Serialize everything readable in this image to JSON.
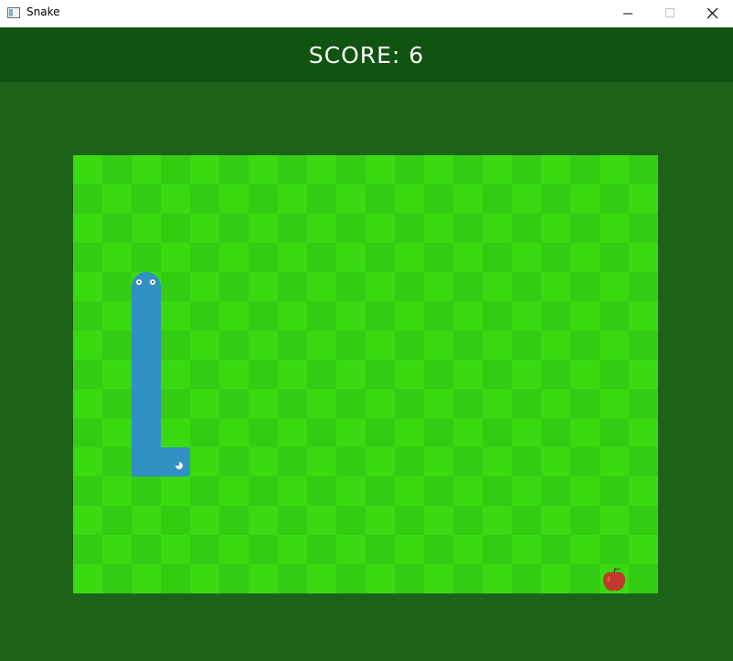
{
  "window": {
    "title": "Snake"
  },
  "hud": {
    "score_text": "SCORE: 6"
  },
  "game": {
    "score": 6,
    "grid": {
      "columns": 20,
      "rows": 15
    },
    "snake": {
      "direction": "up",
      "cells": [
        [
          2,
          4
        ],
        [
          2,
          5
        ],
        [
          2,
          6
        ],
        [
          2,
          7
        ],
        [
          2,
          8
        ],
        [
          2,
          9
        ],
        [
          2,
          10
        ],
        [
          3,
          10
        ]
      ]
    },
    "apple": {
      "cell": [
        18,
        14
      ]
    }
  },
  "colors": {
    "background": "#1c6319",
    "header": "#115310",
    "board_light": "#3ad912",
    "board_dark": "#33cc12",
    "snake": "#3290c3",
    "apple": "#c0392b"
  },
  "icons": [
    "app-icon",
    "minimize-icon",
    "maximize-icon",
    "close-icon",
    "apple-icon"
  ]
}
